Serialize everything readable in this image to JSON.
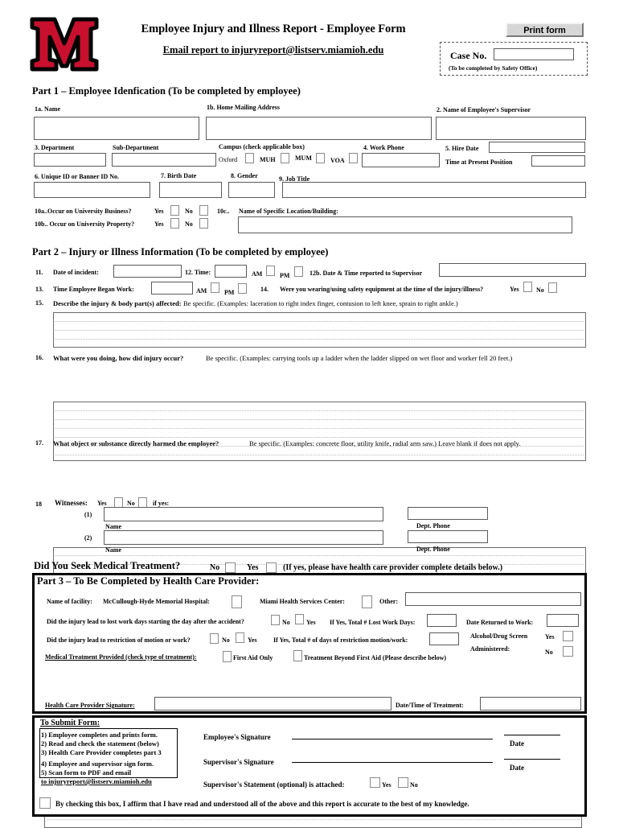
{
  "header": {
    "logo_alt": "Miami University M logo",
    "title": "Employee Injury and Illness Report - Employee Form",
    "subtitle": "Email report to injuryreport@listserv.miamioh.edu",
    "print_button": "Print form",
    "case_label": "Case No.",
    "case_value": "",
    "case_note": "(To be completed by Safety Office)"
  },
  "part1": {
    "heading": "Part 1 – Employee Idenfication (To be completed by employee)",
    "name_label": "1a. Name",
    "name_value": "",
    "address_label": "1b. Home Mailing Address",
    "address_value": "",
    "supervisor_label": "2. Name of Employee's Supervisor",
    "supervisor_value": "",
    "department_label": "3. Department",
    "department_value": "",
    "subdepartment_label": "Sub-Department",
    "subdepartment_value": "",
    "campus_label": "Campus (check applicable box)",
    "campus_options": [
      "Oxford",
      "MUH",
      "MUM",
      "VOA"
    ],
    "work_phone_label": "4. Work Phone",
    "work_phone_value": "",
    "hire_date_label": "5. Hire Date",
    "hire_date_value": "",
    "time_present_label": "Time at Present Position",
    "time_present_value": "",
    "unique_id_label": "6. Unique ID or Banner ID No.",
    "unique_id_value": "",
    "birth_date_label": "7. Birth Date",
    "birth_date_value": "",
    "gender_label": "8. Gender",
    "gender_value": "",
    "job_title_label": "9. Job Title",
    "job_title_value": "",
    "q10a": "10a..Occur on University Business?",
    "q10b": "10b.. Occur on University Property?",
    "yes": "Yes",
    "no": "No",
    "q10c": "10c..",
    "q10c_label": "Name of Specific Location/Building:",
    "q10c_value": ""
  },
  "part2": {
    "heading": "Part 2 – Injury or Illness Information (To be completed by employee)",
    "q11_num": "11.",
    "q11_label": "Date of incident:",
    "q11_value": "",
    "q12_label": "12. Time:",
    "q12_value": "",
    "am": "AM",
    "pm": "PM",
    "q12b_label": "12b. Date & Time reported to Supervisor",
    "q12b_value": "",
    "q13_num": "13.",
    "q13_label": "Time Employee Began Work:",
    "q13_value": "",
    "q14_num": "14.",
    "q14_label": "Were you wearing/using safety equipment at the time of the injury/illness?",
    "yes": "Yes",
    "no": "No",
    "q15_num": "15.",
    "q15_bold": "Describe the injury & body part(s) affected:",
    "q15_rest": "Be specific. (Examples: laceration to right index finger, contusion to left knee, sprain to right ankle.)",
    "q15_value": "",
    "q16_num": "16.",
    "q16_bold": "What were you doing, how did injury occur?",
    "q16_rest": "Be specific. (Examples: carrying tools up a ladder when the ladder slipped on wet floor and worker fell 20 feet.)",
    "q16_value": "",
    "q17_num": "17.",
    "q17_bold": "What object or substance directly harmed the employee?",
    "q17_rest": "Be specific.  (Examples: concrete floor, utility knife, radial arm saw.) Leave blank if does not apply.",
    "q17_value": "",
    "q18_num": "18",
    "q18_label": "Witnesses:",
    "q18_ifyes": "if yes:",
    "w1_num": "(1)",
    "w1_value": "",
    "w1_phone": "",
    "w2_num": "(2)",
    "w2_value": "",
    "w2_phone": "",
    "name_caption": "Name",
    "phone_caption": "Dept. Phone"
  },
  "medical_question": {
    "label": "Did You Seek Medical Treatment?",
    "no": "No",
    "yes": "Yes",
    "note": "(If yes, please have health care provider complete details below.)"
  },
  "part3": {
    "heading": "Part 3 – To Be Completed by Health Care Provider:",
    "facility_label": "Name of  facility:",
    "facility_opt1": "McCullough-Hyde Memorial Hospital:",
    "facility_opt2": "Miami Health Services  Center:",
    "facility_other_label": "Other:",
    "facility_other_value": "",
    "lost_days_q": "Did the injury lead to lost work days starting the day after the accident?",
    "no": "No",
    "yes": "Yes",
    "lost_days_total_label": "If Yes, Total # Lost Work Days:",
    "lost_days_total_value": "",
    "return_date_label": "Date Returned to Work:",
    "return_date_value": "",
    "restriction_q": "Did the injury lead to restriction of motion or work?",
    "restriction_total_label": "If Yes, Total # of days of restriction motion/work:",
    "restriction_total_value": "",
    "alcohol_label1": "Alcohol/Drug Screen",
    "alcohol_label2": "Administered:",
    "treatment_label": "Medical Treatment Provided (check type of treatment):",
    "treatment_opt1": "First Aid Only",
    "treatment_opt2": "Treatment Beyond First Aid (Please describe below)",
    "treatment_value": "",
    "provider_sig_label": "Health Care Provider Signature:",
    "provider_sig_value": "",
    "treatment_datetime_label": "Date/Time of Treatment:",
    "treatment_datetime_value": ""
  },
  "submit": {
    "heading": "To Submit Form:",
    "steps": [
      "1) Employee completes and prints form.",
      "2) Read and check the statement (below)",
      "3) Health Care Provider completes part 3",
      "4) Employee and supervisor sign form.",
      "5) Scan form to PDF and email",
      "to injuryreport@listserv.miamioh.edu"
    ],
    "employee_sig_label": "Employee's Signature",
    "supervisor_sig_label": "Supervisor's Signature",
    "date_label_1": "Date",
    "date_label_2": "Date",
    "statement_label": "Supervisor's Statement (optional) is attached:",
    "yes": "Yes",
    "no": "No",
    "affirm": "By checking this box, I affirm that I have read and understood all of the above and this report is accurate to the best of my knowledge."
  }
}
